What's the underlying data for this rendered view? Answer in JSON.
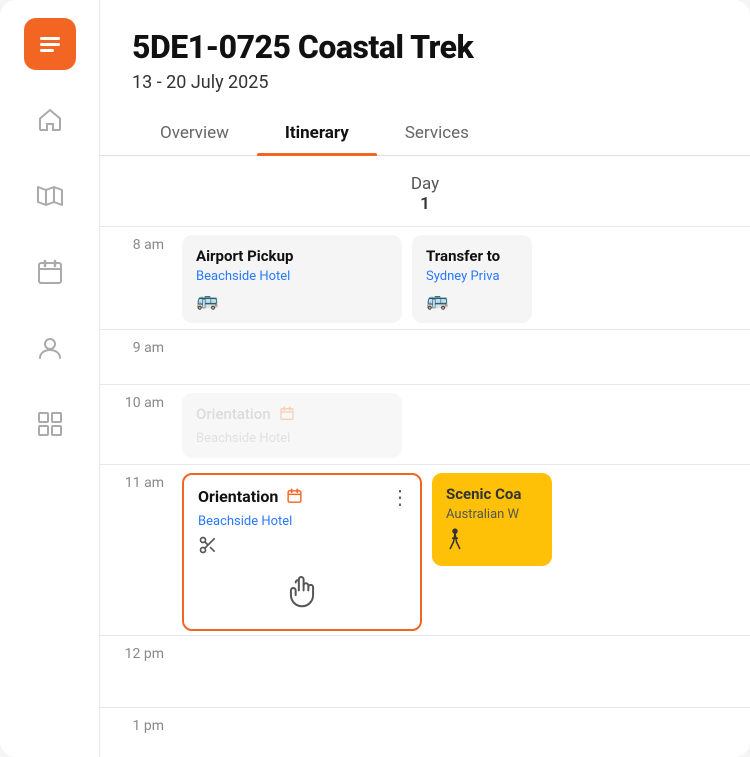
{
  "app": {
    "logo_icon": "menu-list-icon"
  },
  "sidebar": {
    "items": [
      {
        "name": "home",
        "icon": "home-icon"
      },
      {
        "name": "map",
        "icon": "map-icon"
      },
      {
        "name": "calendar",
        "icon": "calendar-icon"
      },
      {
        "name": "person",
        "icon": "person-icon"
      },
      {
        "name": "grid",
        "icon": "grid-icon"
      }
    ]
  },
  "header": {
    "trip_code": "5DE1-0725 Coastal Trek",
    "dates": "13 - 20 July 2025"
  },
  "tabs": [
    {
      "id": "overview",
      "label": "Overview",
      "active": false
    },
    {
      "id": "itinerary",
      "label": "Itinerary",
      "active": true
    },
    {
      "id": "services",
      "label": "Services",
      "active": false
    }
  ],
  "day": {
    "label": "Day",
    "number": "1"
  },
  "schedule": {
    "rows": [
      {
        "time": "8 am",
        "cards": [
          {
            "type": "normal",
            "title": "Airport Pickup",
            "subtitle": "Beachside Hotel",
            "icon": "bus-icon"
          },
          {
            "type": "partial",
            "title": "Transfer to",
            "subtitle": "Sydney Priva",
            "icon": "bus-icon"
          }
        ]
      },
      {
        "time": "9 am",
        "cards": []
      },
      {
        "time": "10 am",
        "cards": [
          {
            "type": "ghost",
            "title": "Orientation",
            "subtitle": "Beachside Hotel",
            "has_orange_icon": true
          }
        ]
      },
      {
        "time": "11 am",
        "cards": [
          {
            "type": "active",
            "title": "Orientation",
            "subtitle": "Beachside Hotel",
            "icon": "scissors-icon",
            "has_orange_icon": true,
            "show_hand": true
          },
          {
            "type": "yellow",
            "title": "Scenic Coa",
            "subtitle": "Australian W",
            "icon": "walk-icon"
          }
        ]
      },
      {
        "time": "12 pm",
        "cards": []
      },
      {
        "time": "1 pm",
        "cards": []
      }
    ],
    "menu_dots": "⋮"
  }
}
